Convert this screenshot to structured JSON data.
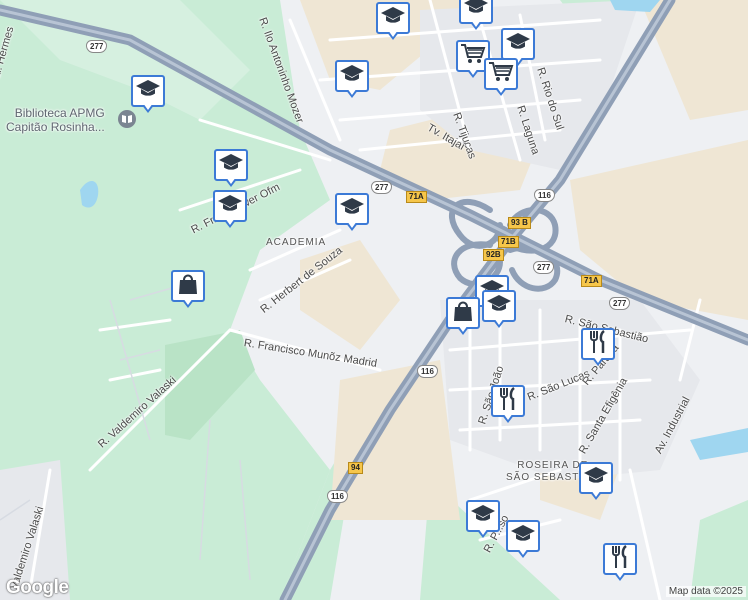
{
  "map": {
    "colors": {
      "background": "#eef0f3",
      "green": "#c9ecd6",
      "sand": "#efe6d4",
      "highway": "#8f9fb6",
      "street": "#ffffff",
      "water": "#9fd6f0",
      "pin_border": "#3c7ad6"
    },
    "street_labels": [
      {
        "id": "r-ilo-antoninho-mozer",
        "text": "R. Ilo Antoninho Mozer"
      },
      {
        "id": "r-rio-do-sul",
        "text": "R. Rio do Sul"
      },
      {
        "id": "r-laguna",
        "text": "R. Laguna"
      },
      {
        "id": "r-tijucas",
        "text": "R. Tijucas"
      },
      {
        "id": "tv-itajai",
        "text": "Tv. Itajaí"
      },
      {
        "id": "r-fr-roewer-ofm",
        "text": "R. Fr... Roewer Ofm"
      },
      {
        "id": "r-herbert-de-souza",
        "text": "R. Herbert de Souza"
      },
      {
        "id": "r-francisco-munoz-madrid",
        "text": "R. Francisco Munõz Madrid"
      },
      {
        "id": "r-valdemiro-valaski-1",
        "text": "R. Valdemiro Valaski"
      },
      {
        "id": "r-valdemiro-valaski-2",
        "text": "Valdemiro Valaski"
      },
      {
        "id": "r-sao-sebastiao",
        "text": "R. São Sebastião"
      },
      {
        "id": "r-sao-joao",
        "text": "R. São João"
      },
      {
        "id": "r-sao-lucas",
        "text": "R. São Lucas"
      },
      {
        "id": "r-parana",
        "text": "R. Paraná"
      },
      {
        "id": "r-santa-efigenia",
        "text": "R. Santa Efigênia"
      },
      {
        "id": "av-industrial",
        "text": "Av. Industrial"
      },
      {
        "id": "r-p-so",
        "text": "R. P...so"
      },
      {
        "id": "hermes",
        "text": "al. Hermes"
      }
    ],
    "poi_labels": [
      {
        "id": "biblioteca",
        "text": "Biblioteca APMG\nCapitão Rosinha..."
      }
    ],
    "area_labels": [
      {
        "id": "academia",
        "text": "ACADEMIA"
      },
      {
        "id": "roseira",
        "text": "ROSEIRA DE\nSÃO SEBASTIÃO"
      }
    ],
    "road_shields": [
      {
        "id": "s277a",
        "text": "277"
      },
      {
        "id": "s277b",
        "text": "277"
      },
      {
        "id": "s277c",
        "text": "277"
      },
      {
        "id": "s277d",
        "text": "277"
      },
      {
        "id": "s116a",
        "text": "116"
      },
      {
        "id": "s116b",
        "text": "116"
      },
      {
        "id": "s116c",
        "text": "116"
      }
    ],
    "exit_labels": [
      {
        "id": "e71a",
        "text": "71A"
      },
      {
        "id": "e93b",
        "text": "93 B"
      },
      {
        "id": "e71b",
        "text": "71B"
      },
      {
        "id": "e92b",
        "text": "92B"
      },
      {
        "id": "e71a2",
        "text": "71A"
      },
      {
        "id": "e94",
        "text": "94"
      }
    ],
    "pins": [
      {
        "id": "school-1",
        "icon": "school-icon"
      },
      {
        "id": "school-2",
        "icon": "school-icon"
      },
      {
        "id": "school-3",
        "icon": "school-icon"
      },
      {
        "id": "school-4",
        "icon": "school-icon"
      },
      {
        "id": "school-5",
        "icon": "school-icon"
      },
      {
        "id": "school-6",
        "icon": "school-icon"
      },
      {
        "id": "school-7",
        "icon": "school-icon"
      },
      {
        "id": "school-8",
        "icon": "school-icon"
      },
      {
        "id": "school-9",
        "icon": "school-icon"
      },
      {
        "id": "school-10",
        "icon": "school-icon"
      },
      {
        "id": "school-11",
        "icon": "school-icon"
      },
      {
        "id": "school-12",
        "icon": "school-icon"
      },
      {
        "id": "school-13",
        "icon": "school-icon"
      },
      {
        "id": "cart-1",
        "icon": "shopping-cart-icon"
      },
      {
        "id": "cart-2",
        "icon": "shopping-cart-icon"
      },
      {
        "id": "bag-1",
        "icon": "shopping-bag-icon"
      },
      {
        "id": "bag-2",
        "icon": "shopping-bag-icon"
      },
      {
        "id": "restaurant-1",
        "icon": "restaurant-icon"
      },
      {
        "id": "restaurant-2",
        "icon": "restaurant-icon"
      },
      {
        "id": "restaurant-3",
        "icon": "restaurant-icon"
      }
    ],
    "attribution": "Map data ©2025",
    "logo": "Google"
  }
}
